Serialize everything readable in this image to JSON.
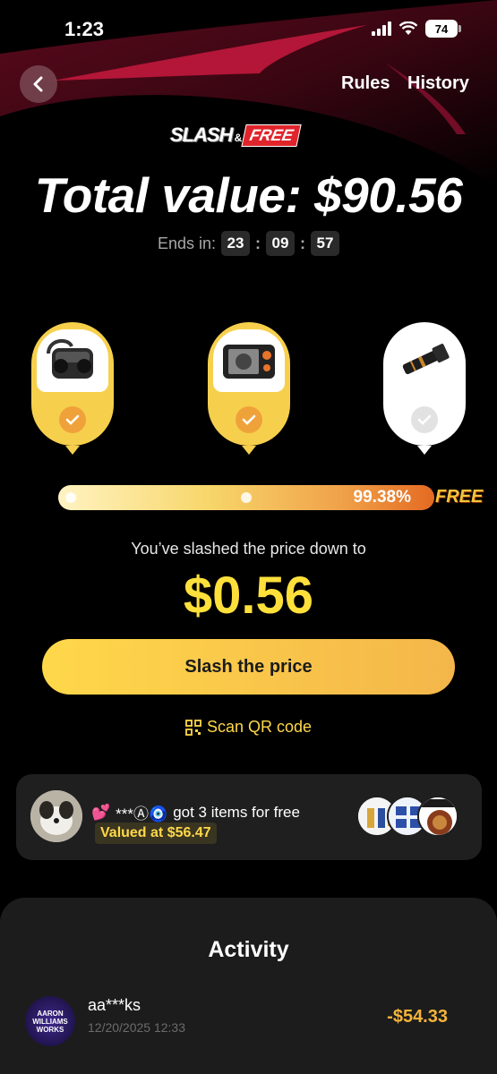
{
  "status_bar": {
    "time": "1:23",
    "battery": "74"
  },
  "header": {
    "rules": "Rules",
    "history": "History"
  },
  "logo": {
    "slash": "SLASH",
    "amp": "&",
    "free": "FREE"
  },
  "total_value": "Total value: $90.56",
  "timer": {
    "label": "Ends in:",
    "hours": "23",
    "minutes": "09",
    "seconds": "57"
  },
  "products": [
    {
      "name": "earbuds",
      "checked": true
    },
    {
      "name": "endoscope",
      "checked": true
    },
    {
      "name": "flashlight",
      "checked": false
    }
  ],
  "progress": {
    "percent_label": "99.38%",
    "value": 0.9938,
    "free_label": "FREE"
  },
  "slashed_text": "You’ve slashed the price down to",
  "price": "$0.56",
  "slash_button": "Slash the price",
  "scan_label": "Scan QR code",
  "winner": {
    "user": "***Ⓐ🧿",
    "text": "got 3 items for free",
    "valued": "Valued at $56.47"
  },
  "activity": {
    "title": "Activity",
    "items": [
      {
        "avatar_text": "AARON WILLIAMS WORKS",
        "name": "aa***ks",
        "date": "12/20/2025 12:33",
        "amount": "-$54.33"
      }
    ]
  },
  "colors": {
    "accent_yellow": "#ffd84a",
    "price_yellow": "#ffe03b",
    "amount_orange": "#f3b43a",
    "pin_yellow": "#f6d04d"
  }
}
